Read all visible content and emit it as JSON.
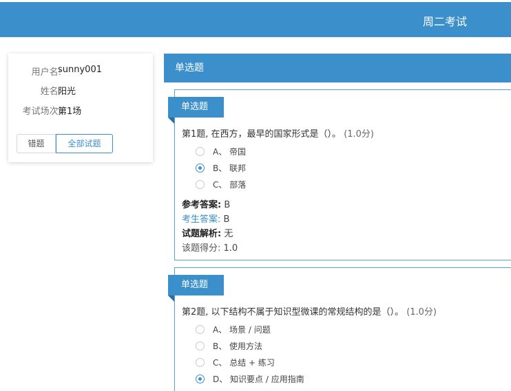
{
  "header": {
    "title": "周二考试"
  },
  "user": {
    "rows": [
      {
        "label": "用户名:",
        "value": "sunny001"
      },
      {
        "label": "姓名:",
        "value": "阳光"
      },
      {
        "label": "考试场次:",
        "value": "第1场"
      }
    ],
    "filters": {
      "wrong_label": "错题",
      "all_label": "全部试题"
    }
  },
  "section": {
    "title": "单选题"
  },
  "questions": [
    {
      "tag": "单选题",
      "text": "第1题, 在西方，最早的国家形式是（）。",
      "score": "(1.0分)",
      "options": [
        {
          "label": "A、 帝国",
          "checked": false
        },
        {
          "label": "B、 联邦",
          "checked": true
        },
        {
          "label": "C、 部落",
          "checked": false
        }
      ],
      "reference_label": "参考答案:",
      "reference_value": "B",
      "student_label": "考生答案:",
      "student_value": "B",
      "analysis_label": "试题解析:",
      "analysis_value": "无",
      "score_label": "该题得分:",
      "score_value": "1.0"
    },
    {
      "tag": "单选题",
      "text": "第2题, 以下结构不属于知识型微课的常规结构的是（）。",
      "score": "(1.0分)",
      "options": [
        {
          "label": "A、 场景 / 问题",
          "checked": false
        },
        {
          "label": "B、 使用方法",
          "checked": false
        },
        {
          "label": "C、 总结 + 练习",
          "checked": false
        },
        {
          "label": "D、 知识要点 / 应用指南",
          "checked": true
        }
      ]
    }
  ]
}
